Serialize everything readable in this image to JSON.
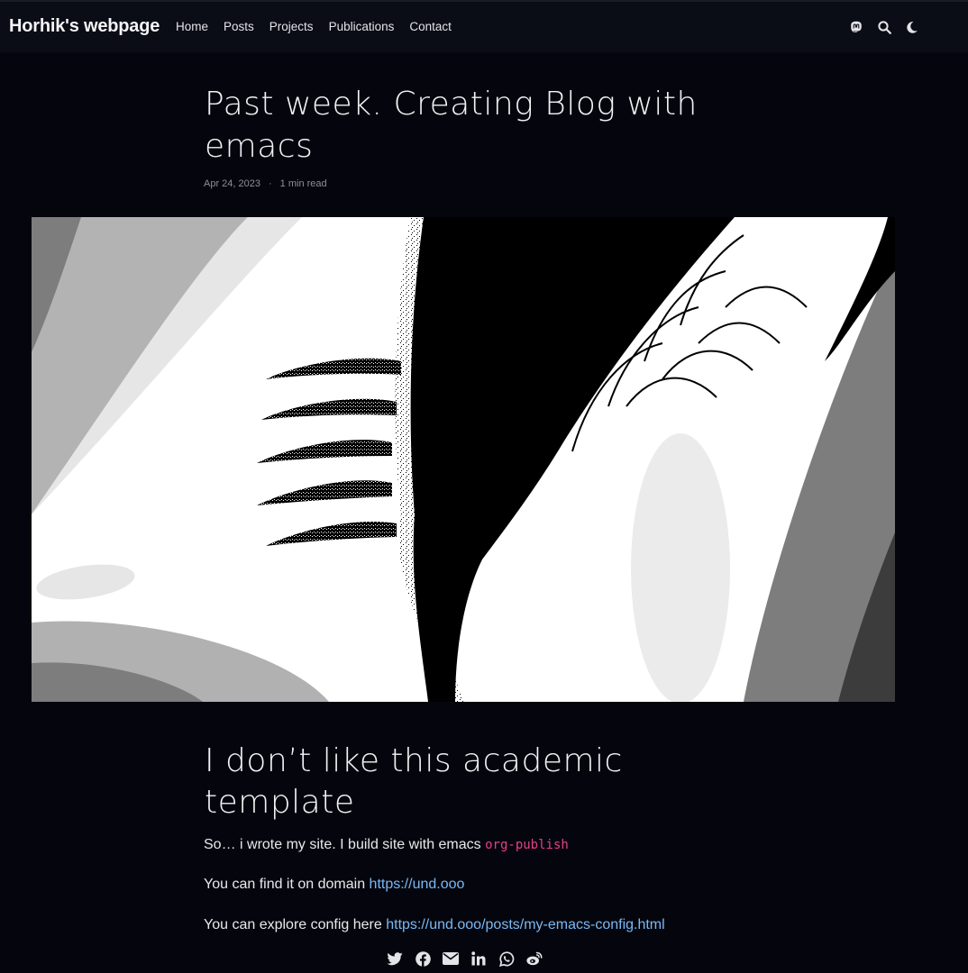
{
  "navbar": {
    "brand": "Horhik's webpage",
    "links": [
      "Home",
      "Posts",
      "Projects",
      "Publications",
      "Contact"
    ],
    "icons": [
      "mastodon-icon",
      "search-icon",
      "moon-icon"
    ]
  },
  "post": {
    "title": "Past week. Creating Blog with emacs",
    "date": "Apr 24, 2023",
    "separator": "·",
    "reading_time": "1 min read",
    "hero_image": "black-and-white-fractal-image",
    "section_heading": "I don’t like this academic template",
    "paragraphs": [
      {
        "text": "So… i wrote my site. I build site with emacs ",
        "code": "org-publish"
      },
      {
        "text": "You can find it on domain ",
        "link": "https://und.ooo"
      },
      {
        "text": "You can explore config here ",
        "link": "https://und.ooo/posts/my-emacs-config.html"
      }
    ]
  },
  "share": {
    "icons": [
      "twitter-icon",
      "facebook-icon",
      "email-icon",
      "linkedin-icon",
      "whatsapp-icon",
      "weibo-icon"
    ]
  },
  "colors": {
    "background": "#05060d",
    "navbar": "#0a0c16",
    "link": "#7ab8f5",
    "code": "#e83e8c"
  }
}
